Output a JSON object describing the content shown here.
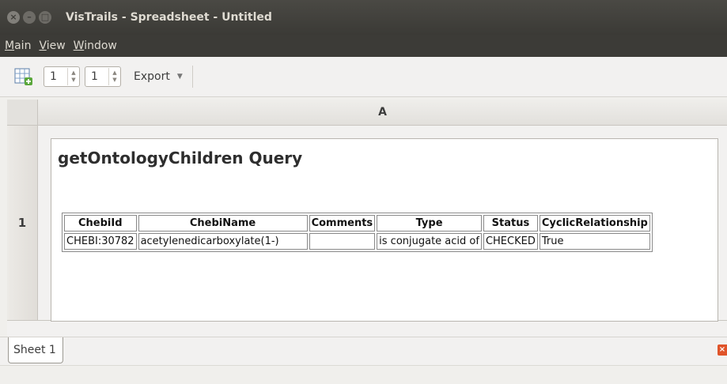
{
  "window": {
    "title": "VisTrails - Spreadsheet - Untitled",
    "buttons": {
      "close": "×",
      "minimize": "–",
      "maximize": "□"
    }
  },
  "menu": {
    "items": [
      {
        "underline": "M",
        "rest": "ain"
      },
      {
        "underline": "V",
        "rest": "iew"
      },
      {
        "underline": "W",
        "rest": "indow"
      }
    ]
  },
  "toolbar": {
    "rows_value": "1",
    "cols_value": "1",
    "export_label": "Export",
    "icons": {
      "add_sheet": "grid-plus-icon",
      "export_caret": "chevron-down-icon"
    },
    "accent": "#5aa73c"
  },
  "spreadsheet": {
    "column_header": "A",
    "row_header": "1",
    "cell": {
      "title": "getOntologyChildren Query",
      "table": {
        "headers": [
          "ChebiId",
          "ChebiName",
          "Comments",
          "Type",
          "Status",
          "CyclicRelationship"
        ],
        "rows": [
          [
            "CHEBI:30782",
            "acetylenedicarboxylate(1-)",
            "",
            "is conjugate acid of",
            "CHECKED",
            "True"
          ]
        ]
      }
    }
  },
  "sheets": {
    "tabs": [
      {
        "label": "Sheet 1"
      }
    ],
    "close_icon": "close-icon",
    "close_color": "#e0542a"
  }
}
